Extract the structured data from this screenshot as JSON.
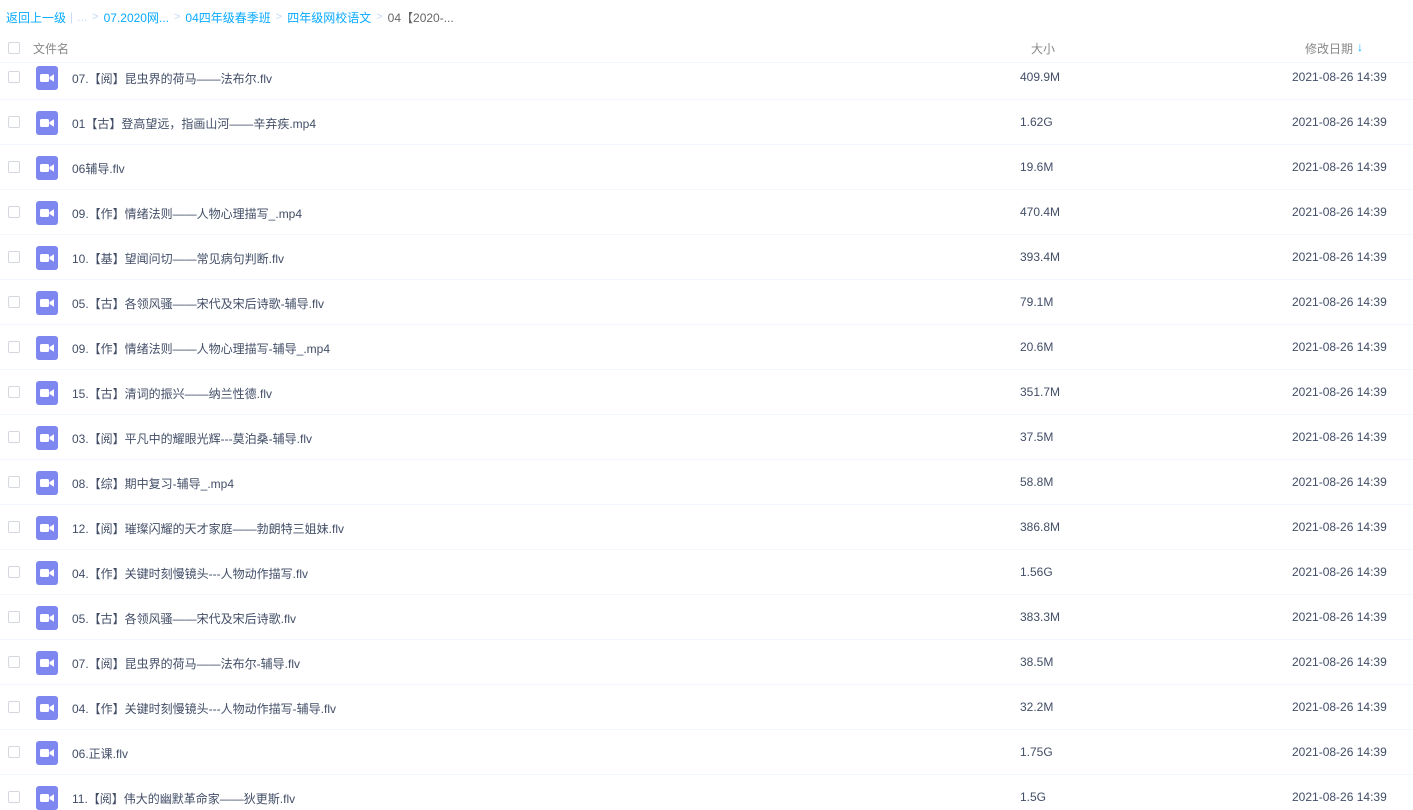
{
  "breadcrumb": {
    "back": "返回上一级",
    "pipe": "|",
    "ellipsis": "...",
    "separator": ">",
    "items": [
      "07.2020网...",
      "04四年级春季班",
      "四年级网校语文"
    ],
    "current": "04【2020-..."
  },
  "header": {
    "name": "文件名",
    "size": "大小",
    "date": "修改日期",
    "sort_arrow": "↓"
  },
  "files": [
    {
      "name": "07.【阅】昆虫界的荷马——法布尔.flv",
      "size": "409.9M",
      "date": "2021-08-26 14:39"
    },
    {
      "name": "01【古】登高望远，指画山河——辛弃疾.mp4",
      "size": "1.62G",
      "date": "2021-08-26 14:39"
    },
    {
      "name": "06辅导.flv",
      "size": "19.6M",
      "date": "2021-08-26 14:39"
    },
    {
      "name": "09.【作】情绪法则——人物心理描写_.mp4",
      "size": "470.4M",
      "date": "2021-08-26 14:39"
    },
    {
      "name": "10.【基】望闻问切——常见病句判断.flv",
      "size": "393.4M",
      "date": "2021-08-26 14:39"
    },
    {
      "name": "05.【古】各领风骚——宋代及宋后诗歌-辅导.flv",
      "size": "79.1M",
      "date": "2021-08-26 14:39"
    },
    {
      "name": "09.【作】情绪法则——人物心理描写-辅导_.mp4",
      "size": "20.6M",
      "date": "2021-08-26 14:39"
    },
    {
      "name": "15.【古】清词的振兴——纳兰性德.flv",
      "size": "351.7M",
      "date": "2021-08-26 14:39"
    },
    {
      "name": "03.【阅】平凡中的耀眼光辉---莫泊桑-辅导.flv",
      "size": "37.5M",
      "date": "2021-08-26 14:39"
    },
    {
      "name": "08.【综】期中复习-辅导_.mp4",
      "size": "58.8M",
      "date": "2021-08-26 14:39"
    },
    {
      "name": "12.【阅】璀璨闪耀的天才家庭——勃朗特三姐妹.flv",
      "size": "386.8M",
      "date": "2021-08-26 14:39"
    },
    {
      "name": "04.【作】关键时刻慢镜头---人物动作描写.flv",
      "size": "1.56G",
      "date": "2021-08-26 14:39"
    },
    {
      "name": "05.【古】各领风骚——宋代及宋后诗歌.flv",
      "size": "383.3M",
      "date": "2021-08-26 14:39"
    },
    {
      "name": "07.【阅】昆虫界的荷马——法布尔-辅导.flv",
      "size": "38.5M",
      "date": "2021-08-26 14:39"
    },
    {
      "name": "04.【作】关键时刻慢镜头---人物动作描写-辅导.flv",
      "size": "32.2M",
      "date": "2021-08-26 14:39"
    },
    {
      "name": "06.正课.flv",
      "size": "1.75G",
      "date": "2021-08-26 14:39"
    },
    {
      "name": "11.【阅】伟大的幽默革命家——狄更斯.flv",
      "size": "1.5G",
      "date": "2021-08-26 14:39"
    }
  ],
  "colors": {
    "link": "#09aaff",
    "icon": "#7e86f0",
    "text": "#424e67"
  },
  "icon": "video-file-icon"
}
